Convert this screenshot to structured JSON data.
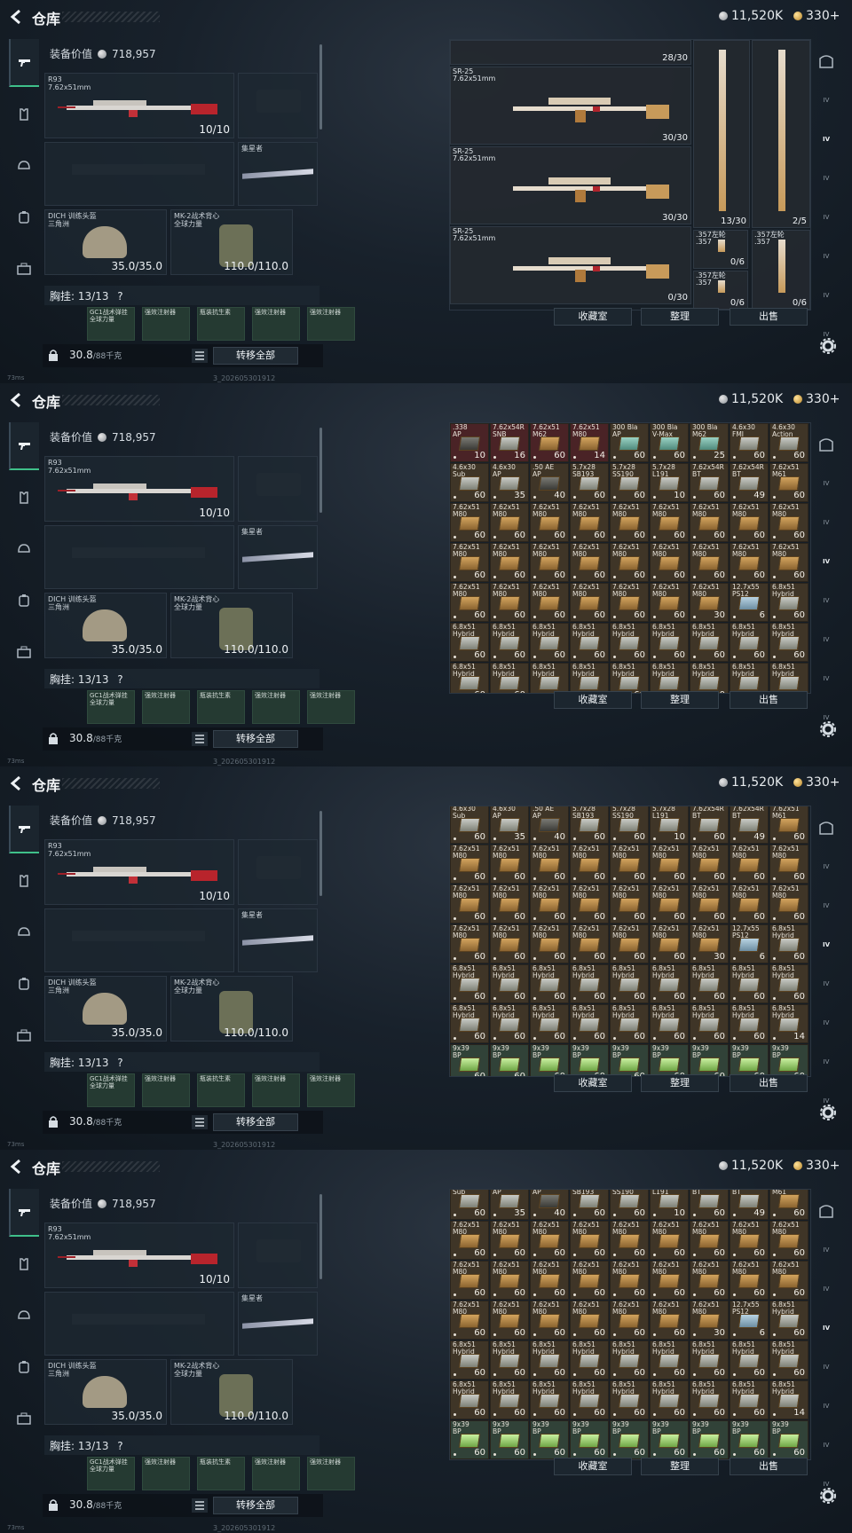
{
  "header": {
    "title": "仓库",
    "silver_amount": "11,520K",
    "gold_amount": "330+"
  },
  "left_nav": [
    "weapon-icon",
    "armor-icon",
    "helmet-icon",
    "backpack-icon",
    "case-icon"
  ],
  "right_nav": [
    "safe-icon",
    "IV",
    "IV",
    "IV",
    "IV",
    "IV",
    "IV",
    "IV"
  ],
  "loadout": {
    "equip_value_label": "装备价值",
    "equip_value": "718,957",
    "primary": {
      "name": "R93",
      "caliber": "7.62x51mm",
      "count": "10/10"
    },
    "melee": {
      "name": "集星者"
    },
    "helmet": {
      "name": "DICH 训练头盔",
      "sub": "三角洲",
      "durability": "35.0/35.0"
    },
    "vest": {
      "name": "MK-2战术背心",
      "sub": "全球力量",
      "durability": "110.0/110.0"
    },
    "chest_label": "胸挂:",
    "chest_count": "13/13",
    "chest_help": "?",
    "chest_slots": [
      "GC1战术弹挂 全球力量",
      "强效注射器",
      "瓶装抗生素",
      "强效注射器",
      "强效注射器"
    ],
    "weight": "30.8",
    "weight_unit": "/88千克",
    "transfer_all": "转移全部"
  },
  "buttons": {
    "collection": "收藏室",
    "sort": "整理",
    "sell": "出售"
  },
  "status": {
    "ping": "73ms",
    "build": "3_202605301912"
  },
  "frame1_weapons": [
    {
      "name": "SR-25",
      "caliber": "7.62x51mm",
      "count": "30/30"
    },
    {
      "name": "SR-25",
      "caliber": "7.62x51mm",
      "count": "30/30"
    },
    {
      "name": "SR-25",
      "caliber": "7.62x51mm",
      "count": "0/30"
    }
  ],
  "frame1_top_count": "28/30",
  "frame1_side": [
    {
      "name": "",
      "count": "13/30"
    },
    {
      "name": "",
      "count": "2/5"
    },
    {
      "name": ".357左轮\n.357",
      "count": "0/6"
    },
    {
      "name": ".357左轮\n.357",
      "count": "0/6"
    },
    {
      "name": ".357左轮\n.357",
      "count": "0/6"
    }
  ],
  "ammo_rows": [
    [
      {
        "l": ".338\nAP",
        "q": "10",
        "c": "red",
        "b": "dark"
      },
      {
        "l": "7.62x54R\nSNB",
        "q": "16",
        "c": "red",
        "b": "silver"
      },
      {
        "l": "7.62x51\nM62",
        "q": "60",
        "c": "red",
        "b": ""
      },
      {
        "l": "7.62x51\nM80",
        "q": "14",
        "c": "red",
        "b": ""
      },
      {
        "l": "300 Bla\nAP",
        "q": "60",
        "c": "",
        "b": "teal"
      },
      {
        "l": "300 Bla\nV-Max",
        "q": "60",
        "c": "",
        "b": "teal"
      },
      {
        "l": "300 Bla\nM62",
        "q": "25",
        "c": "",
        "b": "teal"
      },
      {
        "l": "4.6x30\nFMJ",
        "q": "60",
        "c": "",
        "b": "silver"
      },
      {
        "l": "4.6x30\nAction",
        "q": "60",
        "c": "",
        "b": "silver"
      }
    ],
    [
      {
        "l": "4.6x30\nSub",
        "q": "60",
        "c": "",
        "b": "silver"
      },
      {
        "l": "4.6x30\nAP",
        "q": "35",
        "c": "",
        "b": "silver"
      },
      {
        "l": ".50 AE\nAP",
        "q": "40",
        "c": "",
        "b": "dark"
      },
      {
        "l": "5.7x28\nSB193",
        "q": "60",
        "c": "",
        "b": "silver"
      },
      {
        "l": "5.7x28\nSS190",
        "q": "60",
        "c": "",
        "b": "silver"
      },
      {
        "l": "5.7x28\nL191",
        "q": "10",
        "c": "",
        "b": "silver"
      },
      {
        "l": "7.62x54R\nBT",
        "q": "60",
        "c": "",
        "b": "silver"
      },
      {
        "l": "7.62x54R\nBT",
        "q": "49",
        "c": "",
        "b": "silver"
      },
      {
        "l": "7.62x51\nM61",
        "q": "60",
        "c": "",
        "b": ""
      }
    ],
    [
      {
        "l": "7.62x51\nM80",
        "q": "60",
        "c": "",
        "b": ""
      },
      {
        "l": "7.62x51\nM80",
        "q": "60",
        "c": "",
        "b": ""
      },
      {
        "l": "7.62x51\nM80",
        "q": "60",
        "c": "",
        "b": ""
      },
      {
        "l": "7.62x51\nM80",
        "q": "60",
        "c": "",
        "b": ""
      },
      {
        "l": "7.62x51\nM80",
        "q": "60",
        "c": "",
        "b": ""
      },
      {
        "l": "7.62x51\nM80",
        "q": "60",
        "c": "",
        "b": ""
      },
      {
        "l": "7.62x51\nM80",
        "q": "60",
        "c": "",
        "b": ""
      },
      {
        "l": "7.62x51\nM80",
        "q": "60",
        "c": "",
        "b": ""
      },
      {
        "l": "7.62x51\nM80",
        "q": "60",
        "c": "",
        "b": ""
      }
    ],
    [
      {
        "l": "7.62x51\nM80",
        "q": "60",
        "c": "",
        "b": ""
      },
      {
        "l": "7.62x51\nM80",
        "q": "60",
        "c": "",
        "b": ""
      },
      {
        "l": "7.62x51\nM80",
        "q": "60",
        "c": "",
        "b": ""
      },
      {
        "l": "7.62x51\nM80",
        "q": "60",
        "c": "",
        "b": ""
      },
      {
        "l": "7.62x51\nM80",
        "q": "60",
        "c": "",
        "b": ""
      },
      {
        "l": "7.62x51\nM80",
        "q": "60",
        "c": "",
        "b": ""
      },
      {
        "l": "7.62x51\nM80",
        "q": "60",
        "c": "",
        "b": ""
      },
      {
        "l": "7.62x51\nM80",
        "q": "60",
        "c": "",
        "b": ""
      },
      {
        "l": "7.62x51\nM80",
        "q": "60",
        "c": "",
        "b": ""
      }
    ],
    [
      {
        "l": "7.62x51\nM80",
        "q": "60",
        "c": "",
        "b": ""
      },
      {
        "l": "7.62x51\nM80",
        "q": "60",
        "c": "",
        "b": ""
      },
      {
        "l": "7.62x51\nM80",
        "q": "60",
        "c": "",
        "b": ""
      },
      {
        "l": "7.62x51\nM80",
        "q": "60",
        "c": "",
        "b": ""
      },
      {
        "l": "7.62x51\nM80",
        "q": "60",
        "c": "",
        "b": ""
      },
      {
        "l": "7.62x51\nM80",
        "q": "60",
        "c": "",
        "b": ""
      },
      {
        "l": "7.62x51\nM80",
        "q": "30",
        "c": "",
        "b": ""
      },
      {
        "l": "12.7x55\nPS12",
        "q": "6",
        "c": "",
        "b": "blue"
      },
      {
        "l": "6.8x51\nHybrid",
        "q": "60",
        "c": "",
        "b": "silver"
      }
    ],
    [
      {
        "l": "6.8x51\nHybrid",
        "q": "60",
        "c": "",
        "b": "silver"
      },
      {
        "l": "6.8x51\nHybrid",
        "q": "60",
        "c": "",
        "b": "silver"
      },
      {
        "l": "6.8x51\nHybrid",
        "q": "60",
        "c": "",
        "b": "silver"
      },
      {
        "l": "6.8x51\nHybrid",
        "q": "60",
        "c": "",
        "b": "silver"
      },
      {
        "l": "6.8x51\nHybrid",
        "q": "60",
        "c": "",
        "b": "silver"
      },
      {
        "l": "6.8x51\nHybrid",
        "q": "60",
        "c": "",
        "b": "silver"
      },
      {
        "l": "6.8x51\nHybrid",
        "q": "60",
        "c": "",
        "b": "silver"
      },
      {
        "l": "6.8x51\nHybrid",
        "q": "60",
        "c": "",
        "b": "silver"
      },
      {
        "l": "6.8x51\nHybrid",
        "q": "60",
        "c": "",
        "b": "silver"
      }
    ],
    [
      {
        "l": "6.8x51\nHybrid",
        "q": "60",
        "c": "",
        "b": "silver"
      },
      {
        "l": "6.8x51\nHybrid",
        "q": "60",
        "c": "",
        "b": "silver"
      },
      {
        "l": "6.8x51\nHybrid",
        "q": "60",
        "c": "",
        "b": "silver"
      },
      {
        "l": "6.8x51\nHybrid",
        "q": "60",
        "c": "",
        "b": "silver"
      },
      {
        "l": "6.8x51\nHybrid",
        "q": "60",
        "c": "",
        "b": "silver"
      },
      {
        "l": "6.8x51\nHybrid",
        "q": "60",
        "c": "",
        "b": "silver"
      },
      {
        "l": "6.8x51\nHybrid",
        "q": "60",
        "c": "",
        "b": "silver"
      },
      {
        "l": "6.8x51\nHybrid",
        "q": "60",
        "c": "",
        "b": "silver"
      },
      {
        "l": "6.8x51\nHybrid",
        "q": "14",
        "c": "",
        "b": "silver"
      }
    ],
    [
      {
        "l": "9x39\nBP",
        "q": "60",
        "c": "green",
        "b": "lime"
      },
      {
        "l": "9x39\nBP",
        "q": "60",
        "c": "green",
        "b": "lime"
      },
      {
        "l": "9x39\nBP",
        "q": "60",
        "c": "green",
        "b": "lime"
      },
      {
        "l": "9x39\nBP",
        "q": "60",
        "c": "green",
        "b": "lime"
      },
      {
        "l": "9x39\nBP",
        "q": "60",
        "c": "green",
        "b": "lime"
      },
      {
        "l": "9x39\nBP",
        "q": "60",
        "c": "green",
        "b": "lime"
      },
      {
        "l": "9x39\nBP",
        "q": "60",
        "c": "green",
        "b": "lime"
      },
      {
        "l": "9x39\nBP",
        "q": "60",
        "c": "green",
        "b": "lime"
      },
      {
        "l": "9x39\nBP",
        "q": "60",
        "c": "green",
        "b": "lime"
      }
    ]
  ],
  "frame_scroll_rows": [
    0,
    0,
    1,
    1
  ],
  "frame_row_offsets": [
    0,
    0,
    8,
    0
  ]
}
